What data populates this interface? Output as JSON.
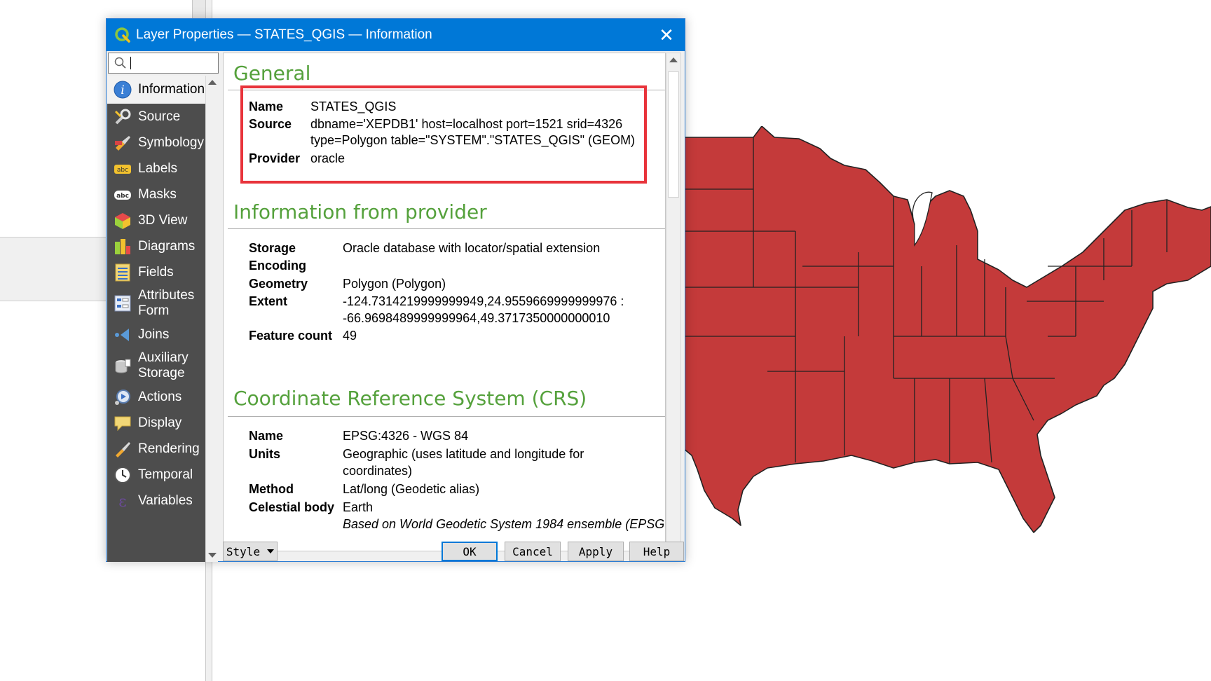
{
  "window": {
    "title": "Layer Properties — STATES_QGIS — Information",
    "close_glyph": "✕"
  },
  "search": {
    "value": ""
  },
  "sidebar": {
    "items": [
      {
        "label": "Information",
        "icon": "info-icon"
      },
      {
        "label": "Source",
        "icon": "source-icon"
      },
      {
        "label": "Symbology",
        "icon": "symbology-icon"
      },
      {
        "label": "Labels",
        "icon": "labels-icon"
      },
      {
        "label": "Masks",
        "icon": "masks-icon"
      },
      {
        "label": "3D View",
        "icon": "3d-view-icon"
      },
      {
        "label": "Diagrams",
        "icon": "diagrams-icon"
      },
      {
        "label": "Fields",
        "icon": "fields-icon"
      },
      {
        "label": "Attributes\nForm",
        "icon": "attributes-form-icon"
      },
      {
        "label": "Joins",
        "icon": "joins-icon"
      },
      {
        "label": "Auxiliary\nStorage",
        "icon": "auxiliary-storage-icon"
      },
      {
        "label": "Actions",
        "icon": "actions-icon"
      },
      {
        "label": "Display",
        "icon": "display-icon"
      },
      {
        "label": "Rendering",
        "icon": "rendering-icon"
      },
      {
        "label": "Temporal",
        "icon": "temporal-icon"
      },
      {
        "label": "Variables",
        "icon": "variables-icon"
      }
    ]
  },
  "general": {
    "heading": "General",
    "name_key": "Name",
    "name_val": "STATES_QGIS",
    "source_key": "Source",
    "source_val_1": "dbname='XEPDB1' host=localhost port=1521 srid=4326",
    "source_val_2": "type=Polygon table=\"SYSTEM\".\"STATES_QGIS\" (GEOM)",
    "provider_key": "Provider",
    "provider_val": "oracle"
  },
  "provider_info": {
    "heading": "Information from provider",
    "storage_key": "Storage",
    "storage_val": "Oracle database with locator/spatial extension",
    "encoding_key": "Encoding",
    "geometry_key": "Geometry",
    "geometry_val": "Polygon (Polygon)",
    "extent_key": "Extent",
    "extent_val_1": "-124.7314219999999949,24.9559669999999976 :",
    "extent_val_2": "-66.9698489999999964,49.3717350000000010",
    "feature_count_key": "Feature count",
    "feature_count_val": "49"
  },
  "crs": {
    "heading": "Coordinate Reference System (CRS)",
    "name_key": "Name",
    "name_val": "EPSG:4326 - WGS 84",
    "units_key": "Units",
    "units_val_1": "Geographic (uses latitude and longitude for",
    "units_val_2": "coordinates)",
    "method_key": "Method",
    "method_val": "Lat/long (Geodetic alias)",
    "celestial_key": "Celestial body",
    "celestial_val": "Earth",
    "next_row_partial": "Based on World Geodetic System 1984 ensemble (EPSG"
  },
  "buttons": {
    "style": "Style",
    "ok": "OK",
    "cancel": "Cancel",
    "apply": "Apply",
    "help": "Help"
  },
  "colors": {
    "titlebar": "#0078d7",
    "section_heading": "#55a13c",
    "highlight_box": "#e8333b",
    "map_fill": "#c43a3a",
    "map_stroke": "#222222"
  }
}
